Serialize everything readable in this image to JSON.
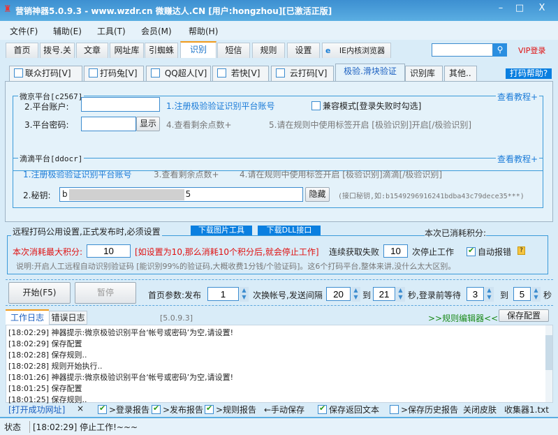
{
  "window": {
    "title": "营销神器5.0.9.3 - www.wzdr.cn 微赚达人.CN [用户:hongzhou][已激活正版]",
    "min": "–",
    "max": "□",
    "close": "X"
  },
  "menu": [
    "文件(F)",
    "辅助(E)",
    "工具(T)",
    "会员(M)",
    "帮助(H)"
  ],
  "tabs": [
    "首页",
    "拨号.关",
    "文章",
    "网址库",
    "引蜘蛛",
    "识别",
    "短信",
    "规则",
    "设置",
    "IE内核浏览器"
  ],
  "search": {
    "value": "",
    "vip": "VIP登录"
  },
  "subtabs": [
    "联众打码[V]",
    "打码兔[V]",
    "QQ超人[V]",
    "若快[V]",
    "云打码[V]",
    "极验.滑块验证",
    "识别库",
    "其他.."
  ],
  "help": "打码帮助?",
  "g1": {
    "title": "微京平台[c2567]",
    "tutorial": "查看教程+",
    "account_label": "2.平台账户:",
    "account": "",
    "reg": "1.注册极验验证识别平台账号",
    "compat": "兼容模式[登录失败时勾选]",
    "pwd_label": "3.平台密码:",
    "pwd": "",
    "show": "显示",
    "points": "4.查看剩余点数+",
    "tip": "5.请在规则中使用标签开启 [极验识别]开启[/极验识别]"
  },
  "g2": {
    "title": "滴滴平台[ddocr]",
    "tutorial": "查看教程+",
    "reg": "1.注册极验验证识别平台账号",
    "points": "3.查看剩余点数+",
    "tip": "4.请在规则中使用标签开启 [极验识别]滴滴[/极验识别]",
    "key_label": "2.秘钥:",
    "key_start": "b",
    "key_end": "5",
    "hide": "隐藏",
    "hint": "(接口秘钥,如:b1549296916241bdba43c79dece35***)"
  },
  "remote": {
    "title": "远程打码公用设置,正式发布时,必须设置",
    "dl_img": "下载图片工具",
    "dl_dll": "下载DLL接口",
    "consumed": "本次已消耗积分:",
    "max_label": "本次消耗最大积分:",
    "max": "10",
    "max_note": "[如设置为10,那么消耗10个积分后,就会停止工作]",
    "fail_label": "连续获取失败",
    "fail": "10",
    "fail_suffix": "次停止工作",
    "auto_report": "自动报错",
    "desc": "说明:开启人工远程自动识别验证码 [能识别99%的验证码,大概收费1分钱/个验证码]。这6个打码平台,整体来讲,没什么太大区别。"
  },
  "controls": {
    "start": "开始(F5)",
    "pause": "暂停",
    "p1": "首页参数:发布",
    "v1": "1",
    "p2": "次换帐号,发送间隔",
    "v2": "20",
    "to": "到",
    "v3": "21",
    "p3": "秒,登录前等待",
    "v4": "3",
    "v5": "5",
    "sec": "秒"
  },
  "log": {
    "tabs": [
      "工作日志",
      "错误日志"
    ],
    "version": "[5.0.9.3]",
    "editor": ">>规则编辑器<<",
    "save": "保存配置",
    "lines": [
      "[18:02:29] 神器提示:微京极验识别平台‘帐号或密码’为空,请设置!",
      "[18:02:29] 保存配置",
      "[18:02:28] 保存规则..",
      "[18:02:28] 规则开始执行..",
      "[18:01:26] 神器提示:微京极验识别平台‘帐号或密码’为空,请设置!",
      "[18:01:25] 保存配置",
      "[18:01:25] 保存规则.."
    ]
  },
  "options": {
    "open_url": "[打开成功网址]",
    "x": "×",
    "login": ">登录报告",
    "publish": ">发布报告",
    "rule": ">规则报告",
    "manual": "←手动保存",
    "save_text": "保存返回文本",
    "history": ">保存历史报告",
    "skin": "关闭皮肤",
    "collector": "收集器1.txt"
  },
  "status": {
    "label": "状态",
    "text": "[18:02:29] 停止工作!~~~"
  }
}
